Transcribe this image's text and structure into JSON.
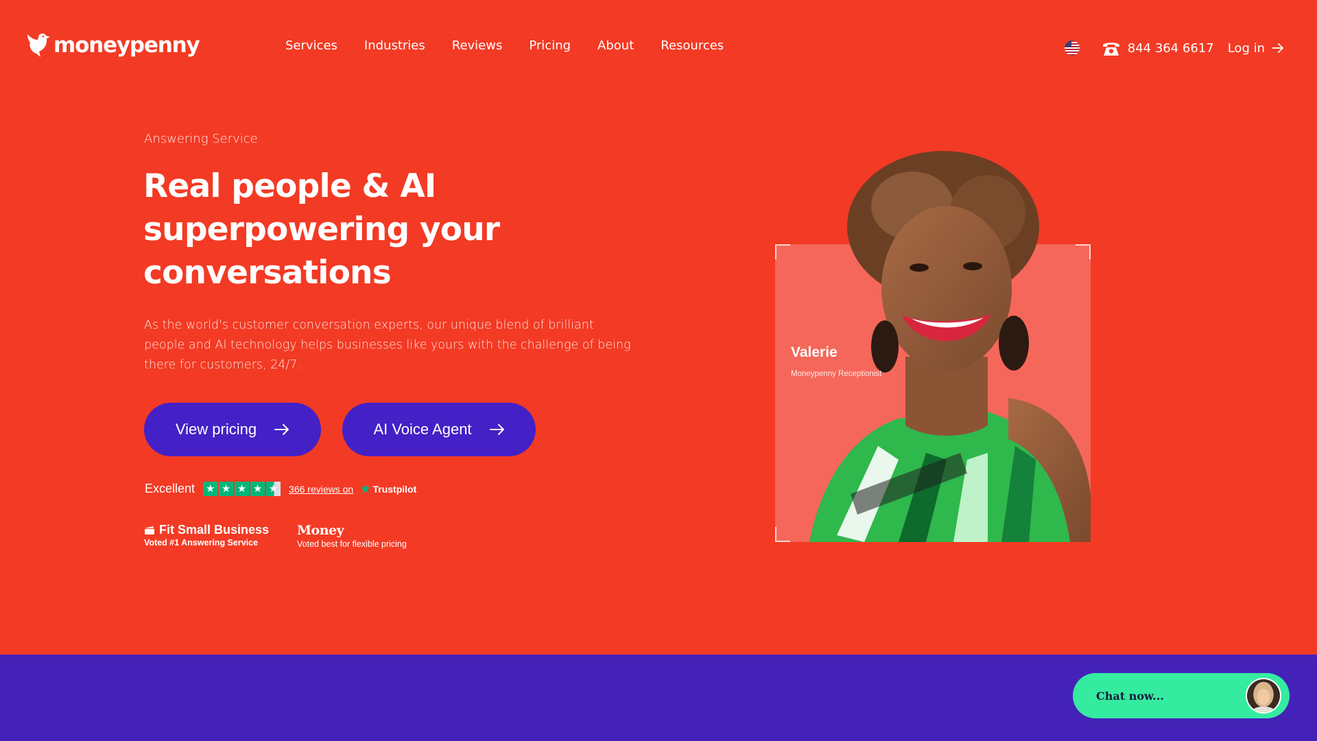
{
  "brand": {
    "logo_text": "moneypenny",
    "logo_icon": "dove-icon"
  },
  "nav": {
    "items": [
      {
        "label": "Services"
      },
      {
        "label": "Industries"
      },
      {
        "label": "Reviews"
      },
      {
        "label": "Pricing"
      },
      {
        "label": "About"
      },
      {
        "label": "Resources"
      }
    ]
  },
  "header_right": {
    "flag_icon": "us-flag-icon",
    "phone_icon": "telephone-icon",
    "phone": "844 364 6617",
    "login": "Log in"
  },
  "hero": {
    "eyebrow": "Answering Service",
    "title": "Real people & AI superpowering your conversations",
    "description": "As the world's customer conversation experts, our unique blend of brilliant people and AI technology helps businesses like yours with the challenge of being there for customers, 24/7.",
    "primary_button": "View pricing",
    "secondary_button": "AI Voice Agent"
  },
  "trustpilot": {
    "rating_word": "Excellent",
    "stars": 4.5,
    "reviews_link": "366 reviews on",
    "brand": "Trustpilot"
  },
  "awards": [
    {
      "name": "Fit Small Business",
      "subtitle": "Voted #1 Answering Service"
    },
    {
      "name": "Money",
      "subtitle": "Voted best for flexible pricing"
    }
  ],
  "portrait": {
    "name": "Valerie",
    "role": "Moneypenny Receptionist"
  },
  "chat": {
    "label": "Chat now..."
  },
  "colors": {
    "hero_bg": "#f33a24",
    "button_bg": "#4321c6",
    "band_bg": "#4422b8",
    "chat_bg": "#35eba0",
    "trustpilot_green": "#00b67a"
  }
}
